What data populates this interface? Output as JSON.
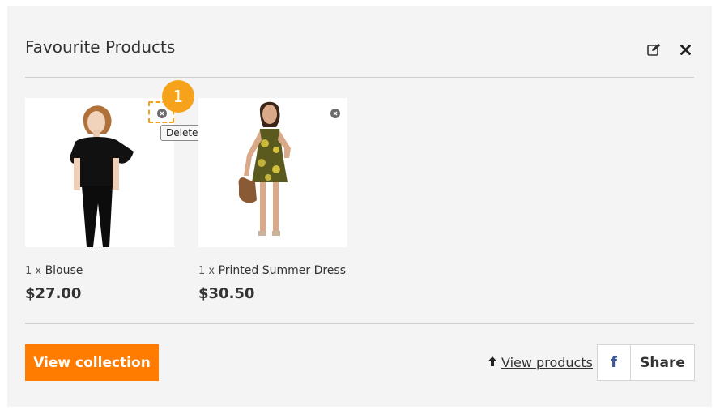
{
  "panel": {
    "title": "Favourite Products",
    "edit_icon": "edit-icon",
    "close_icon": "close-icon"
  },
  "annotation": {
    "step": "1",
    "tooltip": "Delete",
    "highlight_color": "#f0a020",
    "badge_color": "#f7a21b"
  },
  "products": [
    {
      "qty": "1 x",
      "name": "Blouse",
      "price": "$27.00",
      "image": "black-blouse-model"
    },
    {
      "qty": "1 x",
      "name": "Printed Summer Dress",
      "price": "$30.50",
      "image": "yellow-summer-dress-model"
    }
  ],
  "footer": {
    "view_collection": "View collection",
    "view_products": "View products",
    "share": "Share",
    "facebook": "f"
  },
  "colors": {
    "accent": "#ff7c00",
    "facebook": "#3b5998",
    "panel_bg": "#f4f4f4"
  }
}
